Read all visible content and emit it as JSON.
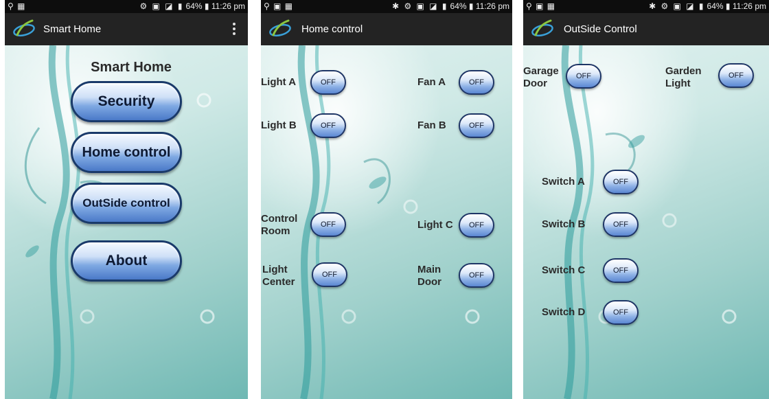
{
  "status_bar": {
    "battery": "64%",
    "time": "11:26 pm"
  },
  "screens": {
    "smart_home": {
      "title": "Smart Home",
      "heading": "Smart Home",
      "buttons": {
        "security": "Security",
        "home_control": "Home control",
        "outside_control": "OutSide control",
        "about": "About"
      }
    },
    "home_control": {
      "title": "Home control",
      "switches": {
        "light_a": {
          "label": "Light A",
          "state": "OFF"
        },
        "fan_a": {
          "label": "Fan A",
          "state": "OFF"
        },
        "light_b": {
          "label": "Light B",
          "state": "OFF"
        },
        "fan_b": {
          "label": "Fan B",
          "state": "OFF"
        },
        "control_room": {
          "label1": "Control",
          "label2": "Room",
          "state": "OFF"
        },
        "light_c": {
          "label": "Light C",
          "state": "OFF"
        },
        "light_center": {
          "label1": "Light",
          "label2": "Center",
          "state": "OFF"
        },
        "main_door": {
          "label1": "Main",
          "label2": "Door",
          "state": "OFF"
        }
      }
    },
    "outside_control": {
      "title": "OutSide Control",
      "switches": {
        "garage_door": {
          "label1": "Garage",
          "label2": "Door",
          "state": "OFF"
        },
        "garden_light": {
          "label1": "Garden",
          "label2": "Light",
          "state": "OFF"
        },
        "switch_a": {
          "label": "Switch A",
          "state": "OFF"
        },
        "switch_b": {
          "label": "Switch B",
          "state": "OFF"
        },
        "switch_c": {
          "label": "Switch C",
          "state": "OFF"
        },
        "switch_d": {
          "label": "Switch D",
          "state": "OFF"
        }
      }
    }
  },
  "colors": {
    "status_bar": "#0d0d0d",
    "app_bar": "#232323",
    "background_teal": "#9fd0cb",
    "button_blue": "#4a79c8",
    "button_border": "#1a3a6a"
  }
}
